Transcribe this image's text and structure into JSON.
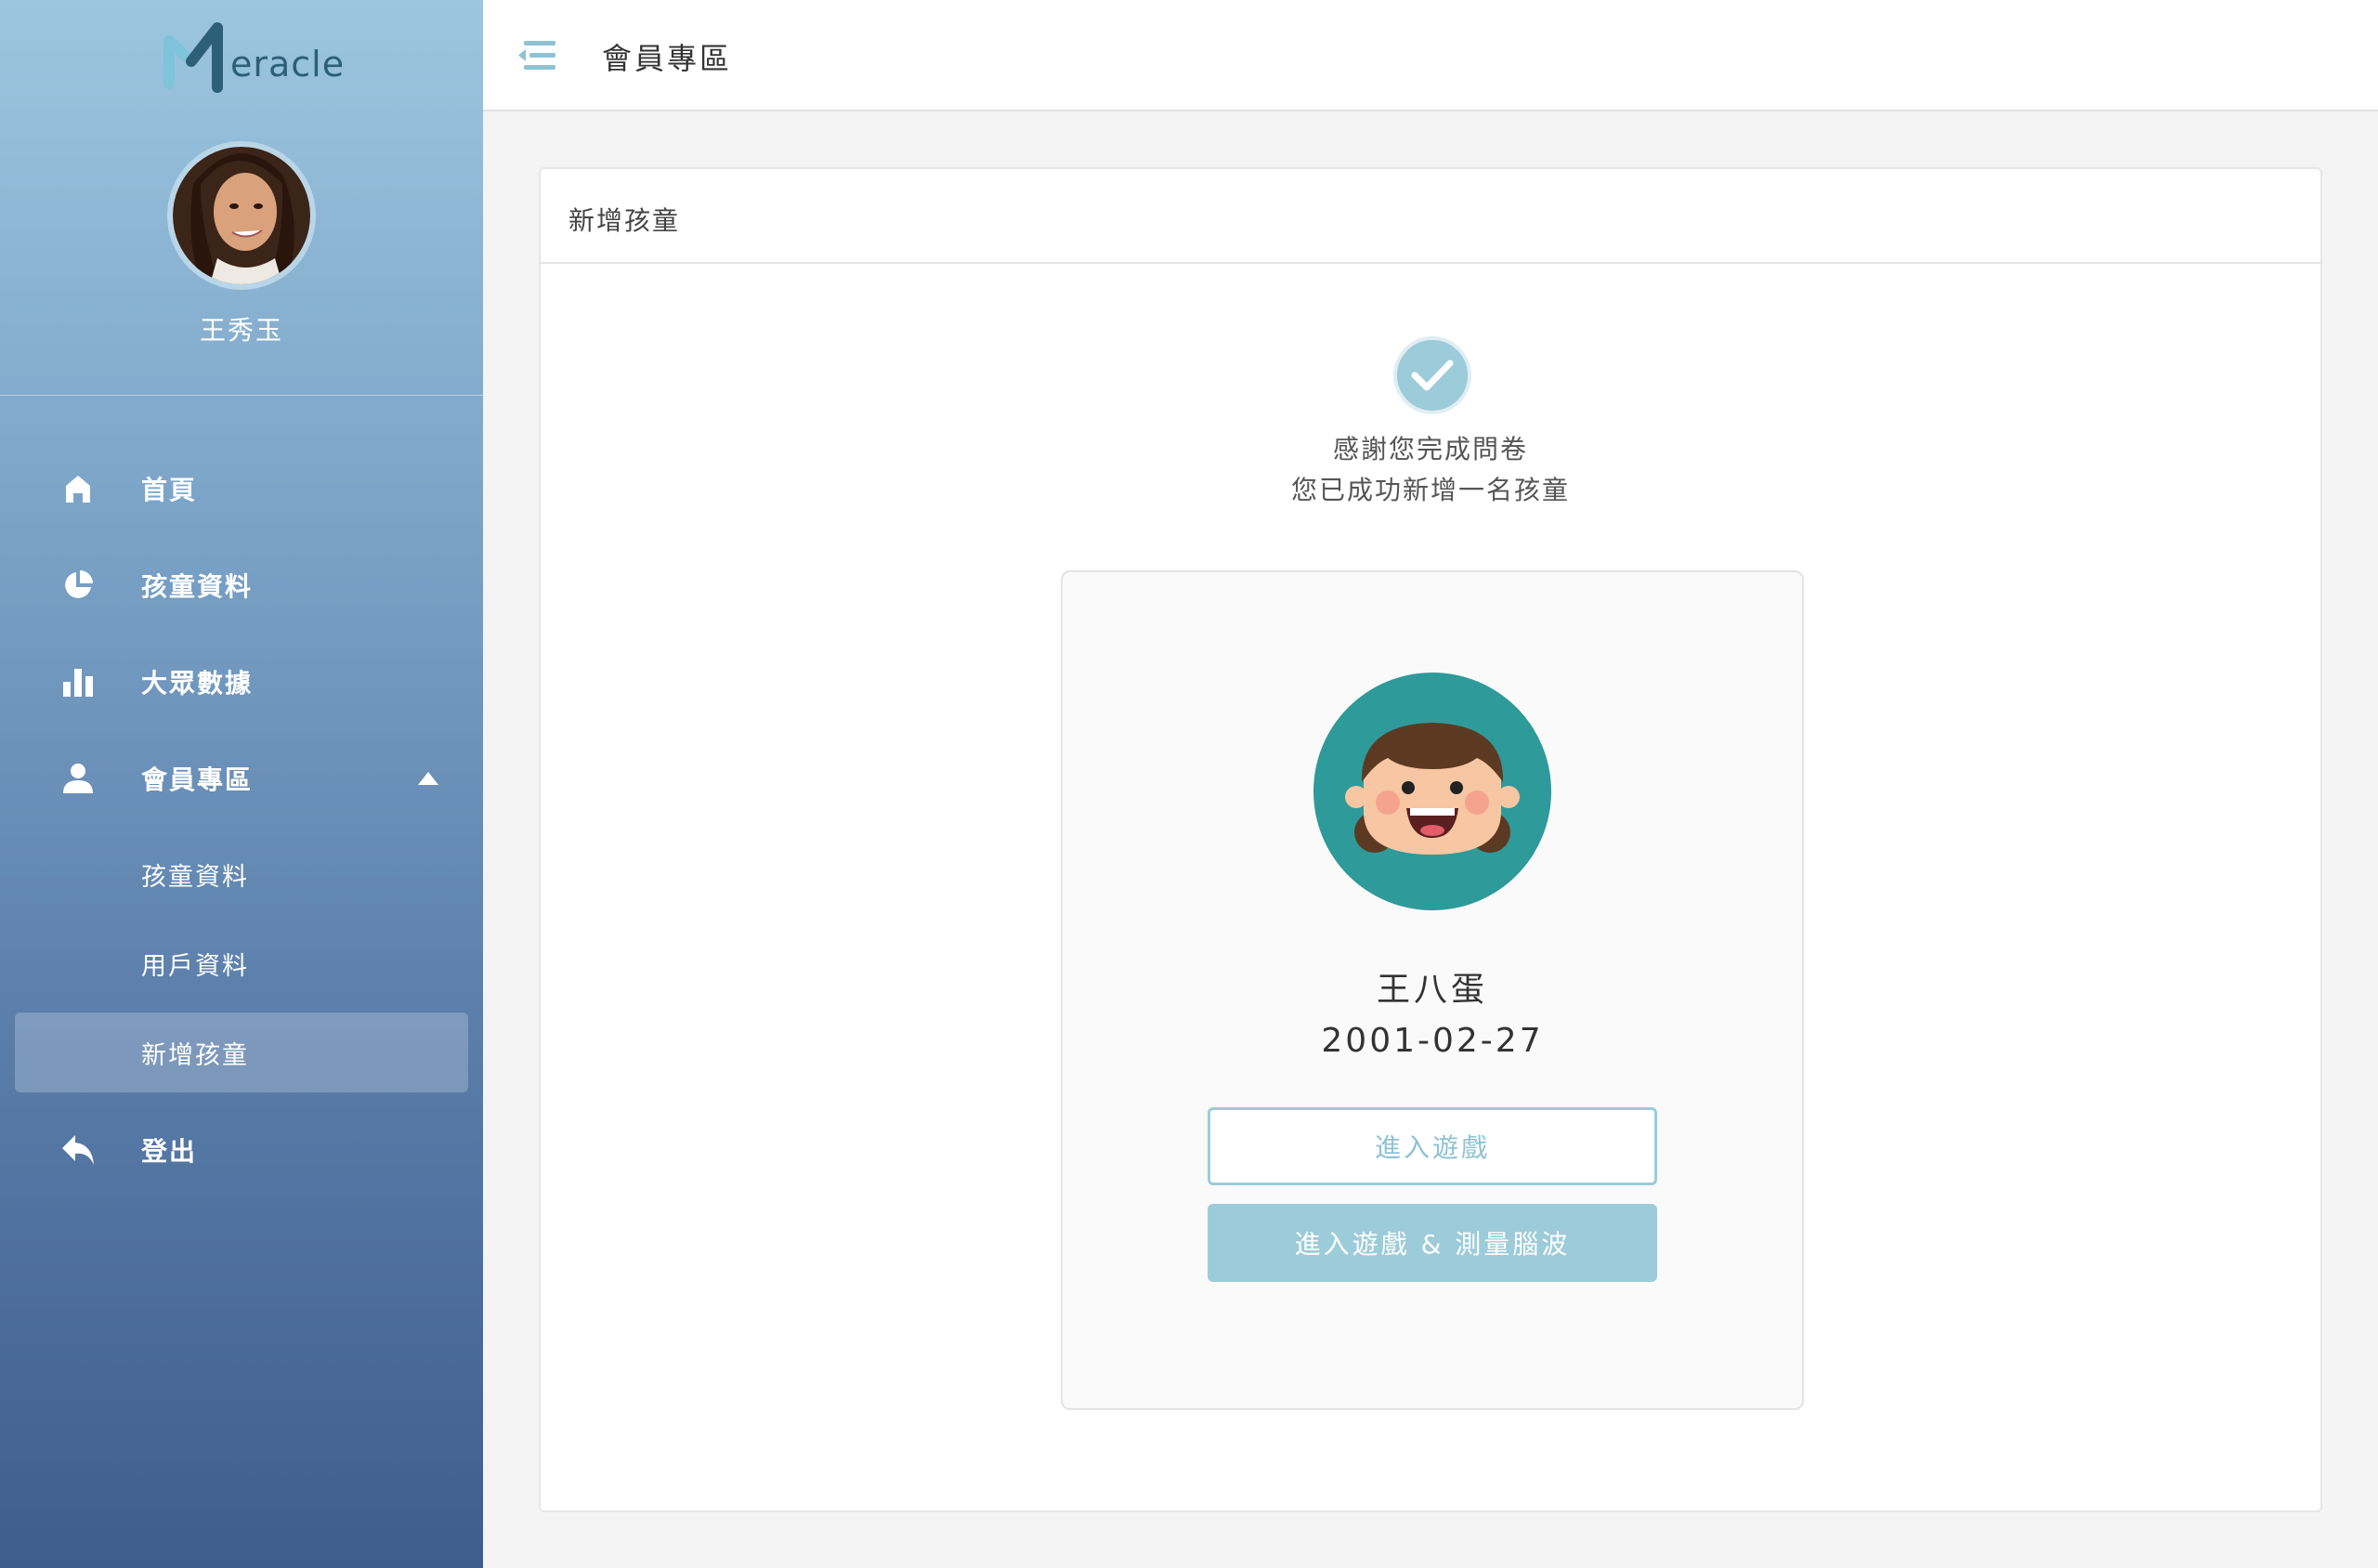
{
  "sidebar": {
    "logo_text": "eracle",
    "user_name": "王秀玉",
    "nav": {
      "home": "首頁",
      "child_data": "孩童資料",
      "public_data": "大眾數據",
      "member": "會員專區",
      "sub_child_data": "孩童資料",
      "sub_user_data": "用戶資料",
      "sub_add_child": "新增孩童",
      "logout": "登出"
    }
  },
  "topbar": {
    "title": "會員專區"
  },
  "card": {
    "title": "新增孩童",
    "message_line1": "感謝您完成問卷",
    "message_line2": "您已成功新增一名孩童",
    "child": {
      "name": "王八蛋",
      "dob": "2001-02-27"
    },
    "buttons": {
      "enter_game": "進入遊戲",
      "enter_game_eeg": "進入遊戲 & 測量腦波"
    }
  },
  "colors": {
    "accent": "#9ccbd9",
    "sidebar_top": "#9cc6df",
    "sidebar_bottom": "#3d5d8e",
    "avatar_bg": "#2e9a9a"
  }
}
